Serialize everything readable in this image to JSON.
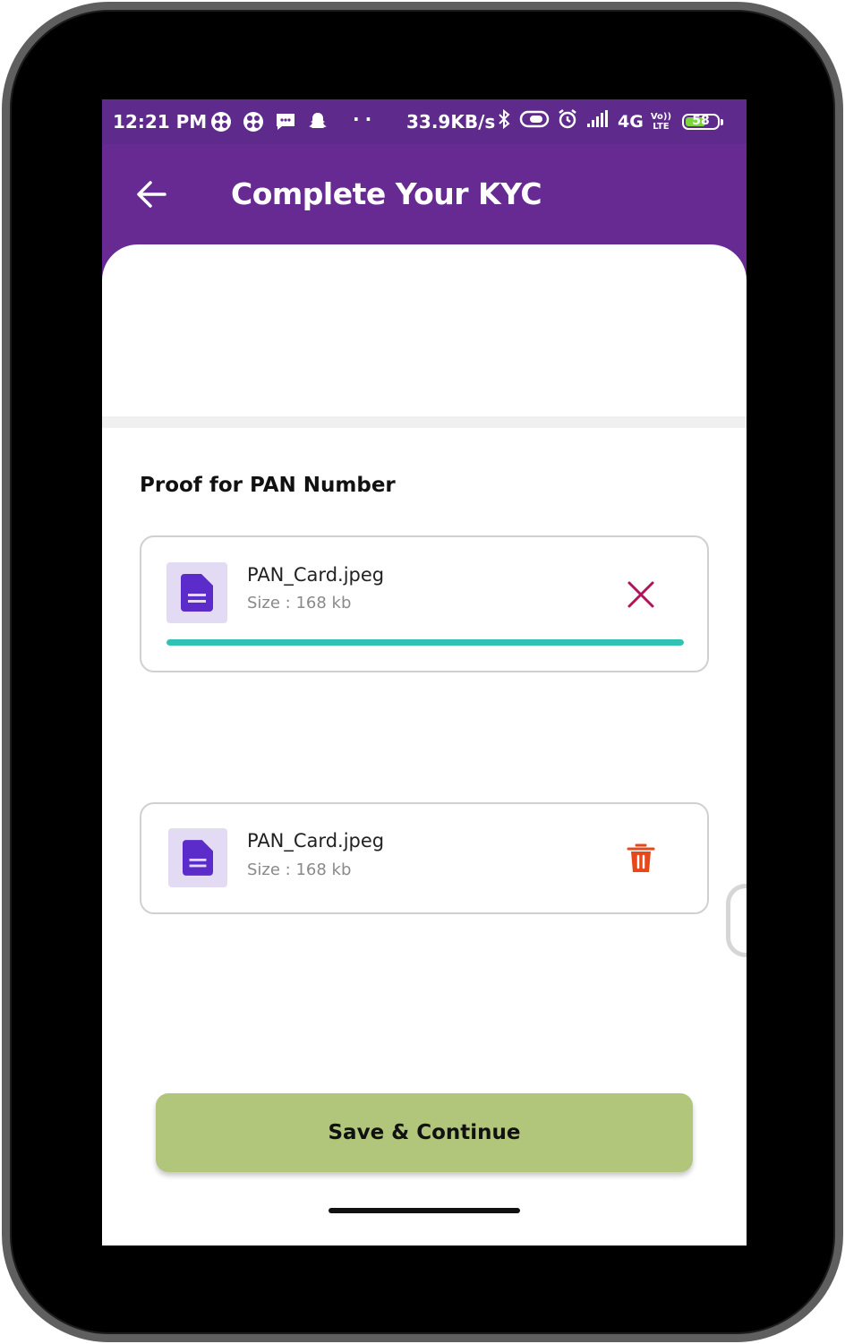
{
  "status_bar": {
    "time": "12:21 PM",
    "notification_icons": [
      "app-grid-icon",
      "app-grid-icon",
      "message-icon",
      "snapchat-icon"
    ],
    "dots": "··",
    "net_speed": "33.9KB/s",
    "network": "4G",
    "volte_line1": "Vo))",
    "volte_line2": "LTE",
    "battery_level": "58"
  },
  "app_bar": {
    "title": "Complete Your KYC",
    "color": "#662a92"
  },
  "section": {
    "title": "Proof for PAN Number"
  },
  "uploads": [
    {
      "file_name": "PAN_Card.jpeg",
      "size": "Size : 168 kb",
      "progress": 1.0,
      "action": "close-icon",
      "action_color": "#b0125b"
    },
    {
      "file_name": "PAN_Card.jpeg",
      "size": "Size : 168 kb",
      "action": "trash-icon",
      "action_color": "#e8471a"
    }
  ],
  "footer": {
    "save_label": "Save & Continue",
    "button_color": "#b1c67b"
  },
  "colors": {
    "status_bar": "#5e2a8c",
    "file_icon_bg": "#e3dbf3",
    "file_icon": "#5b2cc9",
    "progress": "#30c3b4"
  }
}
